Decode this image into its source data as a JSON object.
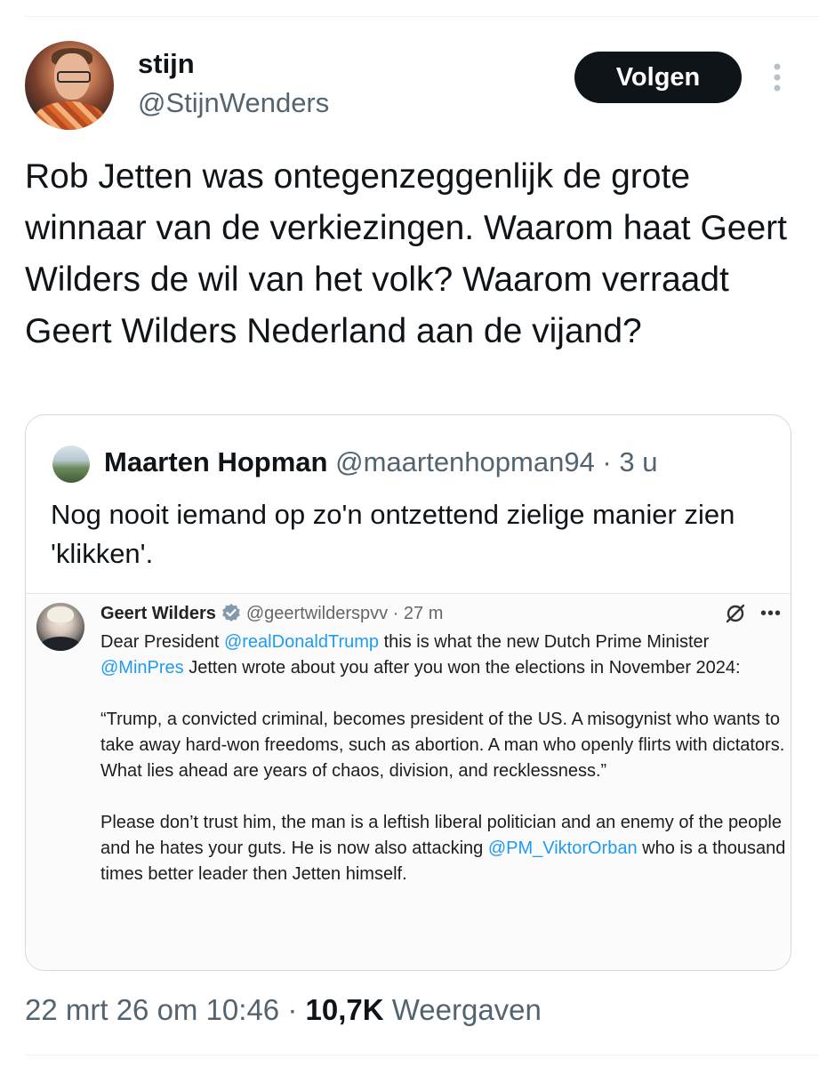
{
  "author": {
    "display_name": "stijn",
    "handle": "@StijnWenders",
    "follow_label": "Volgen"
  },
  "tweet": {
    "text": "Rob Jetten was ontegenzeggenlijk de grote winnaar van de verkiezingen. Waarom haat Geert Wilders de wil van het volk? Waarom verraadt Geert Wilders Nederland aan de vijand?"
  },
  "quote": {
    "name": "Maarten Hopman",
    "handle": "@maartenhopman94",
    "separator": " · ",
    "time": "3 u",
    "text": "Nog nooit iemand op zo'n ontzettend zielige manier zien 'klikken'."
  },
  "embedded": {
    "name": "Geert Wilders",
    "handle": "@geertwilderspvv",
    "separator": " · ",
    "time": "27 m",
    "p1_a": "Dear President ",
    "p1_mention1": "@realDonaldTrump",
    "p1_b": " this is what the new Dutch Prime Minister ",
    "p1_mention2": "@MinPres",
    "p1_c": " Jetten wrote about you after you won the elections in November 2024:",
    "p2": "“Trump, a convicted criminal, becomes president of the US. A misogynist who wants to take away hard-won freedoms, such as abortion. A man who openly flirts with dictators. What lies ahead are years of chaos, division, and recklessness.”",
    "p3_a": "Please don’t trust him, the man is a leftish liberal politician and an enemy of the people and he hates your guts. He is now also attacking ",
    "p3_mention": "@PM_ViktorOrban",
    "p3_b": " who is a thousand times better leader then Jetten himself."
  },
  "meta": {
    "date": "22 mrt 26 om 10:46",
    "separator": " · ",
    "views_count": "10,7K",
    "views_label": " Weergaven"
  },
  "colors": {
    "text": "#0f1419",
    "secondary": "#536471",
    "link": "#1d9bf0",
    "button_bg": "#0f1419",
    "border": "#cfd9de"
  },
  "icons": {
    "more": "more-vertical-icon",
    "verified": "verified-badge-icon",
    "grok": "grok-icon",
    "embed_more": "more-horizontal-icon"
  }
}
